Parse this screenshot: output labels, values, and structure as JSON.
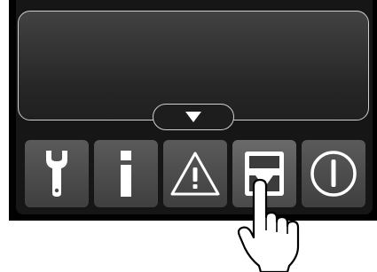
{
  "panel": {
    "colors": {
      "frame": "#000000",
      "display": "#2e2e2e",
      "button": "#4d4d4d",
      "icon": "#ffffff"
    },
    "scroll_tab": {
      "icon": "down-triangle-icon"
    },
    "buttons": [
      {
        "id": "tools",
        "icon": "wrench-icon"
      },
      {
        "id": "info",
        "icon": "info-icon"
      },
      {
        "id": "warning",
        "icon": "warning-triangle-icon"
      },
      {
        "id": "download",
        "icon": "download-tray-icon",
        "state": "pressed"
      },
      {
        "id": "power",
        "icon": "power-icon"
      }
    ],
    "pointer": {
      "icon": "pointing-hand-icon"
    }
  }
}
